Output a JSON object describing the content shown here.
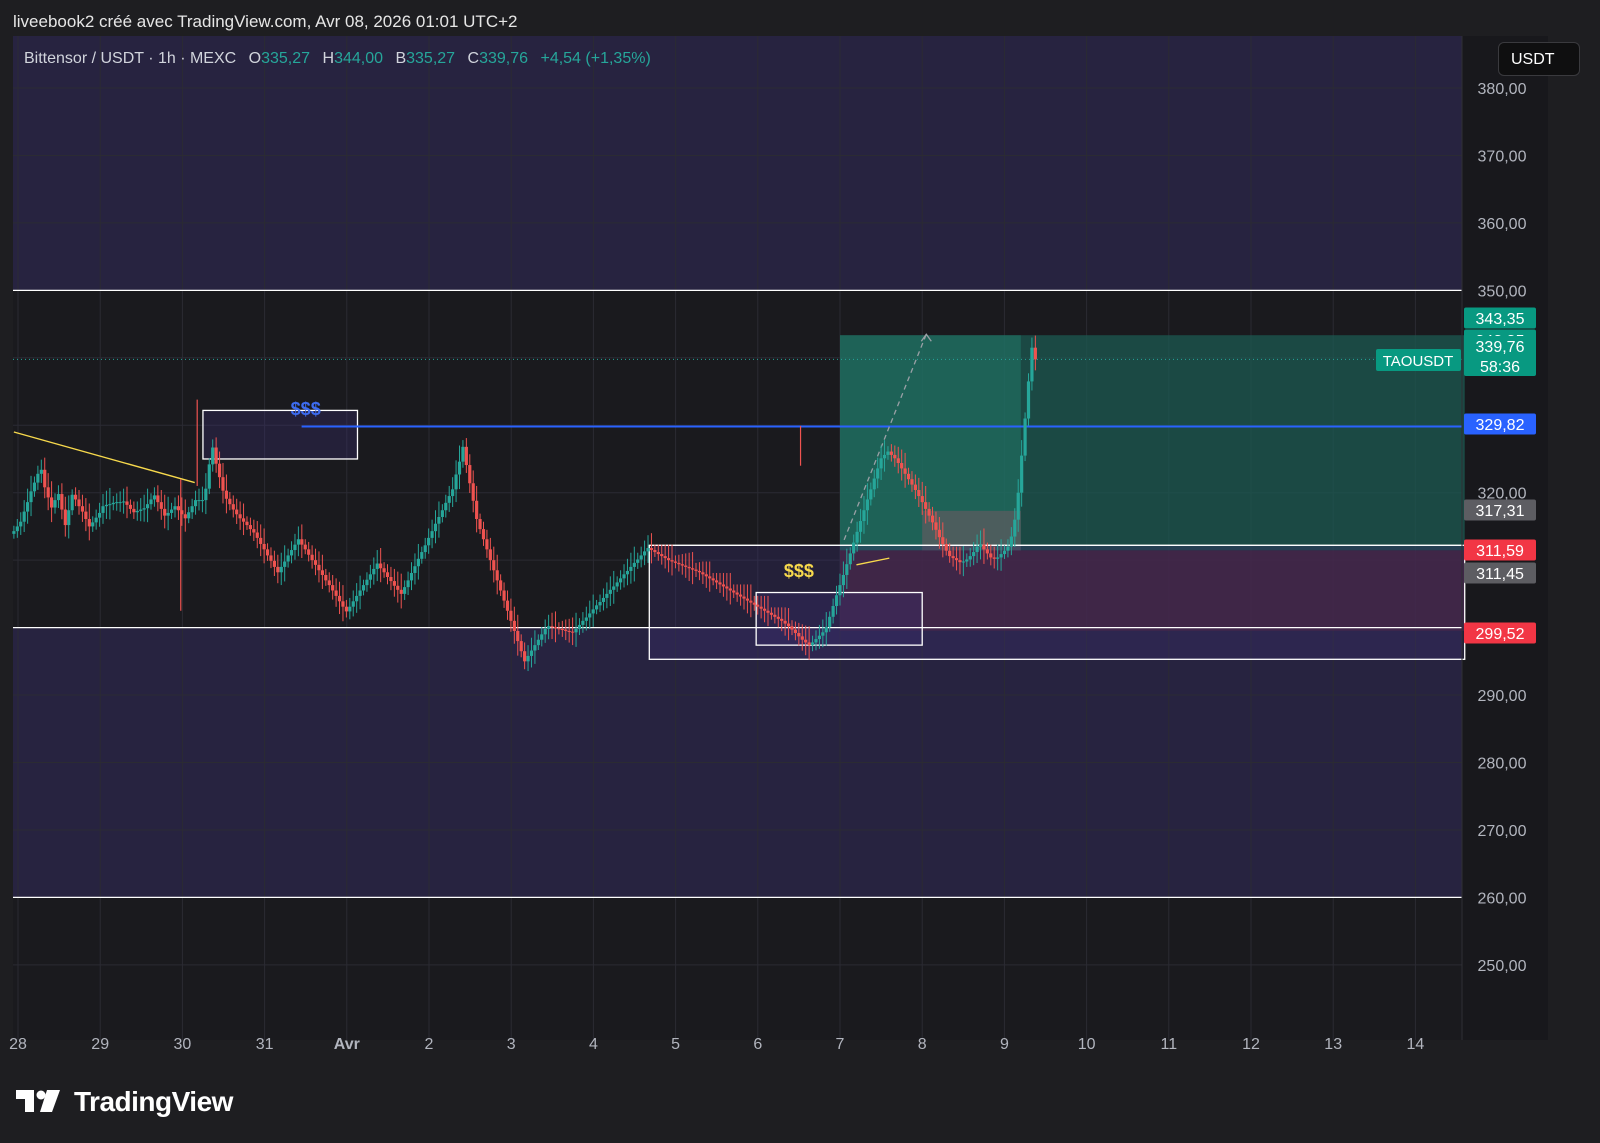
{
  "caption": "liveebook2 créé avec TradingView.com, Avr 08, 2026 01:01 UTC+2",
  "legend": {
    "symbol": "Bittensor / USDT · 1h · MEXC",
    "o_label": "O",
    "o_value": "335,27",
    "h_label": "H",
    "h_value": "344,00",
    "b_label": "B",
    "b_value": "335,27",
    "c_label": "C",
    "c_value": "339,76",
    "change": "+4,54 (+1,35%)"
  },
  "currency_button": "USDT",
  "brand": {
    "name": "TradingView",
    "logo_icon": "tradingview-logo-icon"
  },
  "colors": {
    "background": "#1a1a1e",
    "purple_zone": "#272340",
    "up": "#26a69a",
    "down": "#ef5350",
    "blue_level": "#2962ff",
    "profit_zone": "#1c5a52",
    "loss_zone": "#4a2438",
    "yellow": "#f7d94c"
  },
  "chart_data": {
    "type": "candlestick",
    "title": "Bittensor / USDT · 1h · MEXC",
    "y_ticks": [
      "380,00",
      "370,00",
      "360,00",
      "350,00",
      "320,00",
      "290,00",
      "280,00",
      "270,00",
      "260,00",
      "250,00"
    ],
    "y_tick_values": [
      380,
      370,
      360,
      350,
      320,
      290,
      280,
      270,
      260,
      250
    ],
    "x_ticks": [
      "28",
      "29",
      "30",
      "31",
      "Avr",
      "2",
      "3",
      "4",
      "5",
      "6",
      "7",
      "8",
      "9",
      "10",
      "11",
      "12",
      "13",
      "14"
    ],
    "x_tick_days": [
      28,
      29,
      30,
      31,
      32,
      33,
      34,
      35,
      36,
      37,
      38,
      39,
      40,
      41,
      42,
      43,
      44,
      45
    ],
    "ylim": [
      246,
      388
    ],
    "xlim": [
      27.95,
      45.6
    ],
    "price_labels": [
      {
        "text": "343,35",
        "value": 343.35,
        "color": "#089981"
      },
      {
        "text": "343,35",
        "value": 343.35,
        "color": "#089981"
      },
      {
        "text": "339,76",
        "sub": "58:36",
        "value": 339.76,
        "color": "#089981"
      },
      {
        "text": "329,82",
        "value": 329.82,
        "color": "#2962ff"
      },
      {
        "text": "317,31",
        "value": 317.31,
        "color": "#5d5d62"
      },
      {
        "text": "311,59",
        "value": 311.59,
        "color": "#f23645"
      },
      {
        "text": "311,45",
        "value": 311.45,
        "color": "#5d5d62"
      },
      {
        "text": "299,52",
        "value": 299.52,
        "color": "#f23645"
      }
    ],
    "symbol_tag": "TAOUSDT",
    "last_price": 339.76,
    "range_levels": [
      350,
      300,
      260
    ],
    "blue_level": {
      "value": 329.82,
      "from_day": 31.45
    },
    "liquidity_labels": [
      {
        "text": "$$$",
        "day": 31.5,
        "value": 331.5,
        "color": "#3d6cf0"
      },
      {
        "text": "$$$",
        "day": 37.5,
        "value": 307.5,
        "color": "#f7d94c"
      }
    ],
    "boxes": [
      {
        "from": 30.25,
        "to": 32.13,
        "top": 332.2,
        "bottom": 325.0,
        "fill": "purple",
        "border": "#ffffff"
      },
      {
        "from": 35.68,
        "to": 45.6,
        "top": 312.2,
        "bottom": 295.3,
        "fill": "purple",
        "border": "#ffffff"
      },
      {
        "from": 36.98,
        "to": 39.0,
        "top": 305.2,
        "bottom": 297.4,
        "fill": "purple",
        "border": "#ffffff"
      }
    ],
    "position": {
      "entry_day": 38.0,
      "entry_price": 311.45,
      "target": 343.35,
      "stop": 299.52,
      "end_day": 40.2,
      "zone_end_day": 45.6
    },
    "trendlines": [
      {
        "from_day": 27.95,
        "from_value": 329.0,
        "to_day": 30.15,
        "to_value": 321.5,
        "color": "#f7d94c"
      },
      {
        "from_day": 38.2,
        "from_value": 309.3,
        "to_day": 38.6,
        "to_value": 310.3,
        "color": "#f7d94c"
      }
    ],
    "projection_line": {
      "from_day": 38.05,
      "from_value": 313.0,
      "to_day": 39.05,
      "to_value": 343.5
    },
    "series": [
      {
        "name": "TAOUSDT",
        "x_start_day": 27.95,
        "x_step_days": 0.0417,
        "closes": [
          314.3,
          315.0,
          315.7,
          317.2,
          318.6,
          320.2,
          321.5,
          322.8,
          323.4,
          320.8,
          319.3,
          317.8,
          318.9,
          319.8,
          317.5,
          315.2,
          317.4,
          319.7,
          319.0,
          318.0,
          317.2,
          316.1,
          315.0,
          315.6,
          316.3,
          317.0,
          318.0,
          318.2,
          318.3,
          318.5,
          318.6,
          318.6,
          318.7,
          318.2,
          317.6,
          317.1,
          317.3,
          317.5,
          317.7,
          318.3,
          319.0,
          319.6,
          318.6,
          317.6,
          316.6,
          317.0,
          317.5,
          318.0,
          317.4,
          316.8,
          316.2,
          317.1,
          318.0,
          318.9,
          318.9,
          318.9,
          320.6,
          324.2,
          326.7,
          324.3,
          322.3,
          320.3,
          319.1,
          318.3,
          317.5,
          316.8,
          316.2,
          315.7,
          315.2,
          314.6,
          314.1,
          313.3,
          312.4,
          311.6,
          310.7,
          309.9,
          309.0,
          308.2,
          309.0,
          309.8,
          310.7,
          311.5,
          312.3,
          313.1,
          312.3,
          311.6,
          310.8,
          310.0,
          309.3,
          308.5,
          307.8,
          307.0,
          306.3,
          305.5,
          304.7,
          303.9,
          303.1,
          302.4,
          303.1,
          303.9,
          304.7,
          305.5,
          306.3,
          307.1,
          307.9,
          308.7,
          309.5,
          308.8,
          308.2,
          307.5,
          306.9,
          306.2,
          305.6,
          305.0,
          306.0,
          307.0,
          308.1,
          309.1,
          310.2,
          311.2,
          312.2,
          313.3,
          314.3,
          315.4,
          316.4,
          317.4,
          318.5,
          319.5,
          320.5,
          322.7,
          324.6,
          326.8,
          324.1,
          321.4,
          318.8,
          316.1,
          314.6,
          313.1,
          311.6,
          310.0,
          308.5,
          307.0,
          305.5,
          304.0,
          302.5,
          301.0,
          299.5,
          298.0,
          296.5,
          295.0,
          295.8,
          296.6,
          297.4,
          298.2,
          299.0,
          299.8,
          300.2,
          300.1,
          299.9,
          299.8,
          299.7,
          299.5,
          299.4,
          299.3,
          299.8,
          300.4,
          301.0,
          301.5,
          302.1,
          302.7,
          303.3,
          303.8,
          304.4,
          305.0,
          305.6,
          306.1,
          306.7,
          307.3,
          307.9,
          308.4,
          309.0,
          309.6,
          310.1,
          310.7,
          311.3,
          311.8,
          311.5,
          311.2,
          310.9,
          310.6,
          310.3,
          310.0,
          309.8,
          309.6,
          309.4,
          309.2,
          309.0,
          308.8,
          308.6,
          308.4,
          308.2,
          307.9,
          307.6,
          307.3,
          307.0,
          306.7,
          306.4,
          306.1,
          305.8,
          305.5,
          305.2,
          304.9,
          304.6,
          304.3,
          304.0,
          303.7,
          303.4,
          303.1,
          302.8,
          302.5,
          302.2,
          301.9,
          301.6,
          301.3,
          301.0,
          300.6,
          300.2,
          299.7,
          299.2,
          298.7,
          298.2,
          297.8,
          297.4,
          297.8,
          298.3,
          298.8,
          299.3,
          300.1,
          301.6,
          303.2,
          304.8,
          306.3,
          307.8,
          309.4,
          311.0,
          312.6,
          314.2,
          315.8,
          317.4,
          319.0,
          320.5,
          322.1,
          323.6,
          325.1,
          325.6,
          326.1,
          325.6,
          325.1,
          324.4,
          323.6,
          322.8,
          322.0,
          321.2,
          320.4,
          319.5,
          318.6,
          317.6,
          316.6,
          315.6,
          314.5,
          313.4,
          312.4,
          311.4,
          310.6,
          310.3,
          310.0,
          309.7,
          309.8,
          310.1,
          310.6,
          311.2,
          312.0,
          312.3,
          311.6,
          311.0,
          310.4,
          310.2,
          310.4,
          310.9,
          311.4,
          312.0,
          313.5,
          316.0,
          320.0,
          325.5,
          331.0,
          336.5,
          341.5,
          339.76
        ]
      }
    ]
  }
}
